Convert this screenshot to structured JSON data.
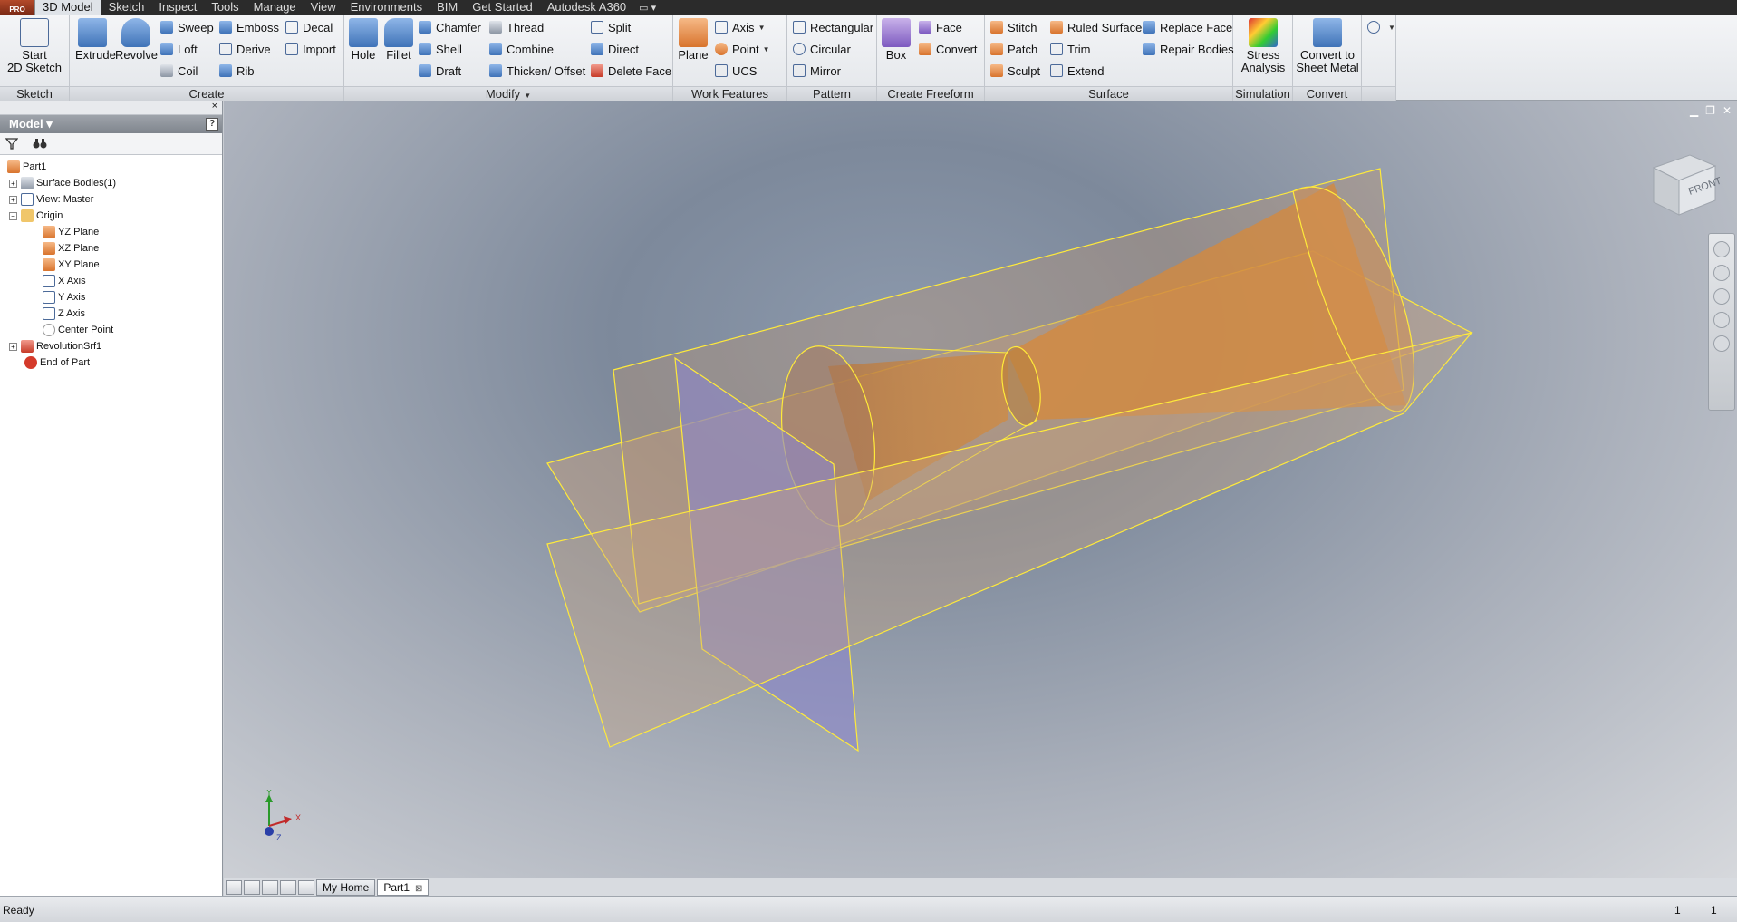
{
  "app": {
    "badge": "PRO",
    "menu_tabs": [
      "3D Model",
      "Sketch",
      "Inspect",
      "Tools",
      "Manage",
      "View",
      "Environments",
      "BIM",
      "Get Started",
      "Autodesk A360"
    ],
    "active_tab": "3D Model"
  },
  "ribbon": {
    "panels": {
      "sketch": "Sketch",
      "create": "Create",
      "modify": "Modify",
      "work_features": "Work Features",
      "pattern": "Pattern",
      "create_freeform": "Create Freeform",
      "surface": "Surface",
      "simulation": "Simulation",
      "convert": "Convert"
    },
    "sketch": {
      "start_sketch_line1": "Start",
      "start_sketch_line2": "2D Sketch"
    },
    "create": {
      "extrude": "Extrude",
      "revolve": "Revolve",
      "sweep": "Sweep",
      "loft": "Loft",
      "coil": "Coil",
      "emboss": "Emboss",
      "derive": "Derive",
      "rib": "Rib",
      "decal": "Decal",
      "import": "Import"
    },
    "modify": {
      "hole": "Hole",
      "fillet": "Fillet",
      "chamfer": "Chamfer",
      "shell": "Shell",
      "draft": "Draft",
      "thread": "Thread",
      "combine": "Combine",
      "thicken_offset": "Thicken/ Offset",
      "split": "Split",
      "direct": "Direct",
      "delete_face": "Delete Face"
    },
    "work_features": {
      "plane": "Plane",
      "axis": "Axis",
      "point": "Point",
      "ucs": "UCS"
    },
    "pattern": {
      "rectangular": "Rectangular",
      "circular": "Circular",
      "mirror": "Mirror"
    },
    "create_freeform": {
      "box": "Box",
      "face": "Face",
      "convert": "Convert"
    },
    "surface": {
      "stitch": "Stitch",
      "patch": "Patch",
      "sculpt": "Sculpt",
      "ruled_surface": "Ruled Surface",
      "trim": "Trim",
      "extend": "Extend",
      "replace_face": "Replace Face",
      "repair_bodies": "Repair Bodies"
    },
    "simulation": {
      "stress_line1": "Stress",
      "stress_line2": "Analysis"
    },
    "convert": {
      "sheet_line1": "Convert to",
      "sheet_line2": "Sheet Metal"
    }
  },
  "browser": {
    "title": "Model",
    "close": "×",
    "help": "?",
    "tree": [
      {
        "label": "Part1",
        "level": 0
      },
      {
        "label": "Surface Bodies(1)",
        "level": 1
      },
      {
        "label": "View: Master",
        "level": 1
      },
      {
        "label": "Origin",
        "level": 1
      },
      {
        "label": "YZ Plane",
        "level": 2
      },
      {
        "label": "XZ Plane",
        "level": 2
      },
      {
        "label": "XY Plane",
        "level": 2
      },
      {
        "label": "X Axis",
        "level": 2
      },
      {
        "label": "Y Axis",
        "level": 2
      },
      {
        "label": "Z Axis",
        "level": 2
      },
      {
        "label": "Center Point",
        "level": 2
      },
      {
        "label": "RevolutionSrf1",
        "level": 1
      },
      {
        "label": "End of Part",
        "level": 1
      }
    ]
  },
  "viewport": {
    "viewcube_front": "FRONT",
    "triad": {
      "x": "X",
      "y": "Y",
      "z": "Z"
    },
    "colors": {
      "surface": "#d98838",
      "plane_yellow": "#ffea3a",
      "plane_blue": "#8a86c8"
    }
  },
  "doc_tabs": {
    "home": "My Home",
    "part": "Part1",
    "close": "⊠"
  },
  "status": {
    "text": "Ready",
    "count_a": "1",
    "count_b": "1"
  }
}
